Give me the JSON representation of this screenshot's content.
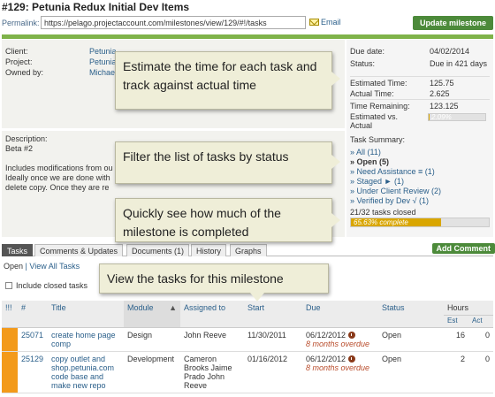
{
  "page": {
    "title": "#129: Petunia Redux Initial Dev Items",
    "permalink_label": "Permalink:",
    "permalink_url": "https://pelago.projectaccount.com/milestones/view/129/#!/tasks",
    "email_label": "Email",
    "update_button": "Update milestone"
  },
  "info": {
    "client_label": "Client:",
    "client_value": "Petunia",
    "project_label": "Project:",
    "project_value": "Petunia",
    "owner_label": "Owned by:",
    "owner_value": "Michae"
  },
  "description": {
    "label": "Description:",
    "line1": "Beta #2",
    "line2": "Includes modifications from ou",
    "line3": "Ideally once we are done with",
    "line4": "delete copy. Once they are re"
  },
  "side": {
    "due_date_label": "Due date:",
    "due_date_value": "04/02/2014",
    "status_label": "Status:",
    "status_value": "Due in 421 days",
    "est_time_label": "Estimated Time:",
    "est_time_value": "125.75",
    "actual_time_label": "Actual Time:",
    "actual_time_value": "2.625",
    "remaining_label": "Time Remaining:",
    "remaining_value": "123.125",
    "est_vs_actual_label": "Estimated vs. Actual",
    "est_vs_actual_text": "2.09%",
    "est_vs_actual_fraction": 0.0209,
    "summary_label": "Task Summary:",
    "summary_items": [
      "» All (11)",
      "» Open (5)",
      "» Need Assistance ≡ (1)",
      "» Staged ► (1)",
      "» Under Client Review (2)",
      "» Verified by Dev √ (1)"
    ],
    "closed_text": "21/32 tasks closed",
    "complete_text": "65.63% complete",
    "complete_fraction": 0.6563
  },
  "tabs": [
    "Tasks",
    "Comments & Updates",
    "Documents (1)",
    "History",
    "Graphs"
  ],
  "add_comment": "Add Comment",
  "subnav": {
    "open": "Open",
    "sep": "|",
    "view_all": "View All Tasks"
  },
  "include_closed": "Include closed tasks",
  "table": {
    "headers": [
      "!!!",
      "#",
      "Title",
      "Module",
      "Assigned to",
      "Start",
      "Due",
      "Status",
      "Hours"
    ],
    "hours_sub": [
      "Est",
      "Act"
    ],
    "rows": [
      {
        "id": "25071",
        "title": "create home page comp",
        "module": "Design",
        "assigned": "John Reeve",
        "start": "11/30/2011",
        "due": "06/12/2012",
        "overdue": "8 months overdue",
        "status": "Open",
        "est": "16",
        "act": "0"
      },
      {
        "id": "25129",
        "title": "copy outlet and shop.petunia.com code base and make new repo",
        "module": "Development",
        "assigned": "Cameron Brooks Jaime Prado John Reeve",
        "start": "01/16/2012",
        "due": "06/12/2012",
        "overdue": "8 months overdue",
        "status": "Open",
        "est": "2",
        "act": "0"
      }
    ]
  },
  "callouts": {
    "estimate": "Estimate the time for each task and track against actual time",
    "filter": "Filter the list of tasks by status",
    "milestone": "Quickly see how much of the milestone is completed",
    "view_tasks": "View the tasks for this milestone"
  },
  "colors": {
    "accent_green": "#4c8a3a",
    "progress": "#d9a600",
    "priority": "#f39a1a"
  }
}
